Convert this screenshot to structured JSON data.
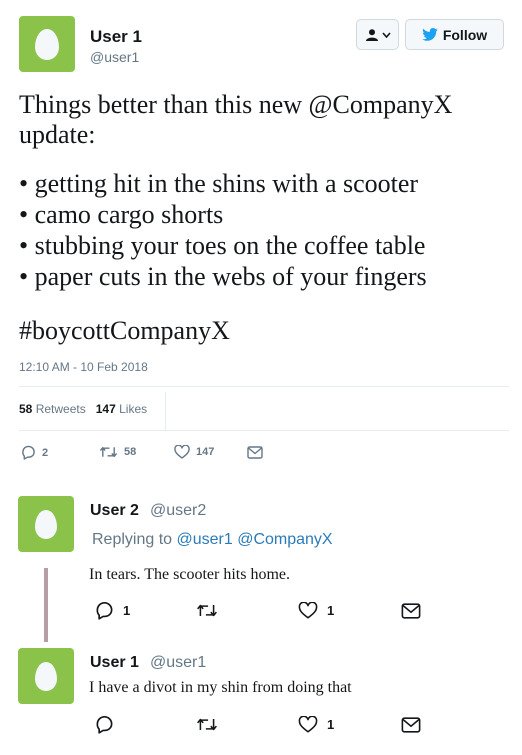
{
  "main_tweet": {
    "user_name": "User 1",
    "user_handle": "@user1",
    "follow_label": "Follow",
    "line1": "Things better than this new @CompanyX",
    "line2": "update:",
    "bullets": [
      "getting hit in the shins with a scooter",
      "camo cargo shorts",
      "stubbing your toes on the coffee table",
      "paper cuts in the webs of your fingers"
    ],
    "hashtag": "#boycottCompanyX",
    "timestamp": "12:10 AM - 10 Feb 2018",
    "retweets_count": "58",
    "retweets_label": "Retweets",
    "likes_count": "147",
    "likes_label": "Likes",
    "actions": {
      "reply_count": "2",
      "retweet_count": "58",
      "like_count": "147"
    }
  },
  "replies": [
    {
      "user_name": "User 2",
      "user_handle": "@user2",
      "replying_prefix": "Replying to",
      "replying_to": "@user1 @CompanyX",
      "text": "In tears. The scooter hits home.",
      "reply_count": "1",
      "retweet_count": "",
      "like_count": "1"
    },
    {
      "user_name": "User 1",
      "user_handle": "@user1",
      "text": "I have a divot in my shin from doing that",
      "reply_count": "",
      "retweet_count": "",
      "like_count": "1"
    }
  ],
  "icons": {
    "avatar_color": "#8bc34a",
    "twitter_blue": "#1da1f2",
    "names": [
      "user-icon",
      "chevron-down-icon",
      "twitter-bird-icon",
      "reply-icon",
      "retweet-icon",
      "like-icon",
      "message-icon"
    ]
  }
}
